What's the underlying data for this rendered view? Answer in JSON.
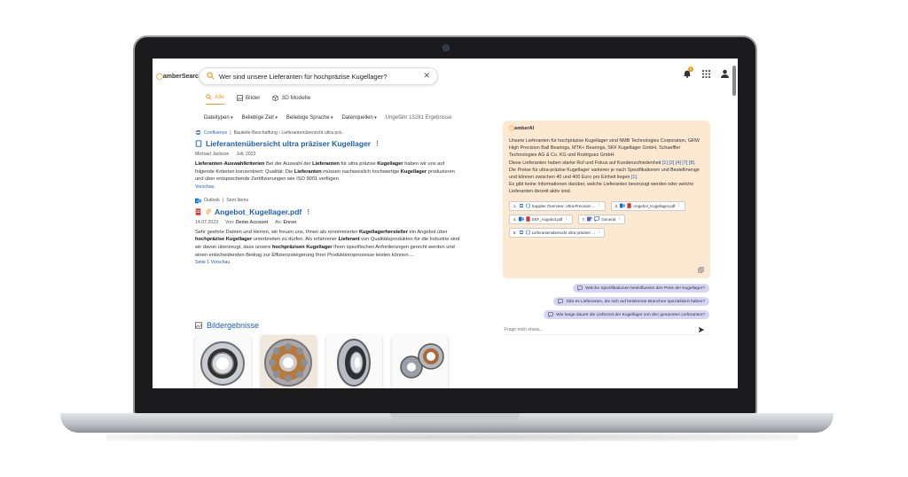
{
  "app": {
    "logo": "amberSearch",
    "ai_logo": "amberAI"
  },
  "search": {
    "query": "Wer sind unsere Lieferanten für hochpräzise Kugellager?",
    "clear": "✕"
  },
  "notifications": {
    "count": "1"
  },
  "tabs": [
    {
      "label": "Alle",
      "active": true
    },
    {
      "label": "Bilder"
    },
    {
      "label": "3D Modelle"
    }
  ],
  "filters": [
    "Dateitypen",
    "Beliebige Zeit",
    "Beliebige Sprache",
    "Datenquellen"
  ],
  "result_count": "Ungefähr 13281 Ergebnisse",
  "results": [
    {
      "source": "Confluence",
      "path": "Bauteile-Beschaffung › Lieferantenübersicht ultra prä..",
      "title": "Lieferantenübersicht ultra präziser Kugellager",
      "author": "Michael Jackson",
      "date": "Juli, 2023",
      "more": "Vorschau"
    },
    {
      "source": "Outlook",
      "path": "Sent Items",
      "title": "Angebot_Kugellager.pdf",
      "date": "14.07.2023",
      "from_label": "Von:",
      "from": "Demo Account",
      "to_label": "An:",
      "to": "Enron",
      "more": "Seite 1 Vorschau"
    }
  ],
  "images_header": "Bildergebnisse",
  "ai": {
    "answer_1": "Unsere Lieferanten für hochpräzise Kugellager sind NMB Technologies Corporation, GRW High Precision Ball Bearings, MTK+ Bearings, SKF Kugellager GmbH, Schaeffler Technologies AG & Co. KG und Rodriguez GmbH.",
    "answer_2": "Diese Lieferanten haben starke Ruf und Fokus auf Kundenzufriedenheit",
    "answer_2_cites": "[1] [2] [4] [7] [8].",
    "answer_3": "Die Preise für ultra-präzise Kugellager variieren je nach Spezifikationen und Bestellmenge und können zwischen 40 und 400 Euro pro Einheit liegen",
    "answer_3_cites": "[1].",
    "answer_4": "Es gibt keine Informationen darüber, welche Lieferanten bevorzugt werden oder welche Lieferanten derzeit aktiv sind.",
    "sources": [
      {
        "num": "1.",
        "label": "Supplier Overview: Ultra-Precision ..."
      },
      {
        "num": "2.",
        "label": "Angebot_Kugellager.pdf"
      },
      {
        "num": "4.",
        "label": "SKF_Angebot.pdf"
      },
      {
        "num": "7.",
        "label": "General"
      },
      {
        "num": "8.",
        "label": "Lieferantenübersicht ultra präziser ..."
      }
    ],
    "suggestions": [
      "Welche Spezifikationen beeinflussen den Preis der Kugellager?",
      "Gibt es Lieferanten, die sich auf bestimmte Branchen spezialisiert haben?",
      "Wie lange dauert die Lieferzeit der Kugellager von den genannten Lieferanten?"
    ],
    "chat_placeholder": "Frage mich etwas..."
  }
}
